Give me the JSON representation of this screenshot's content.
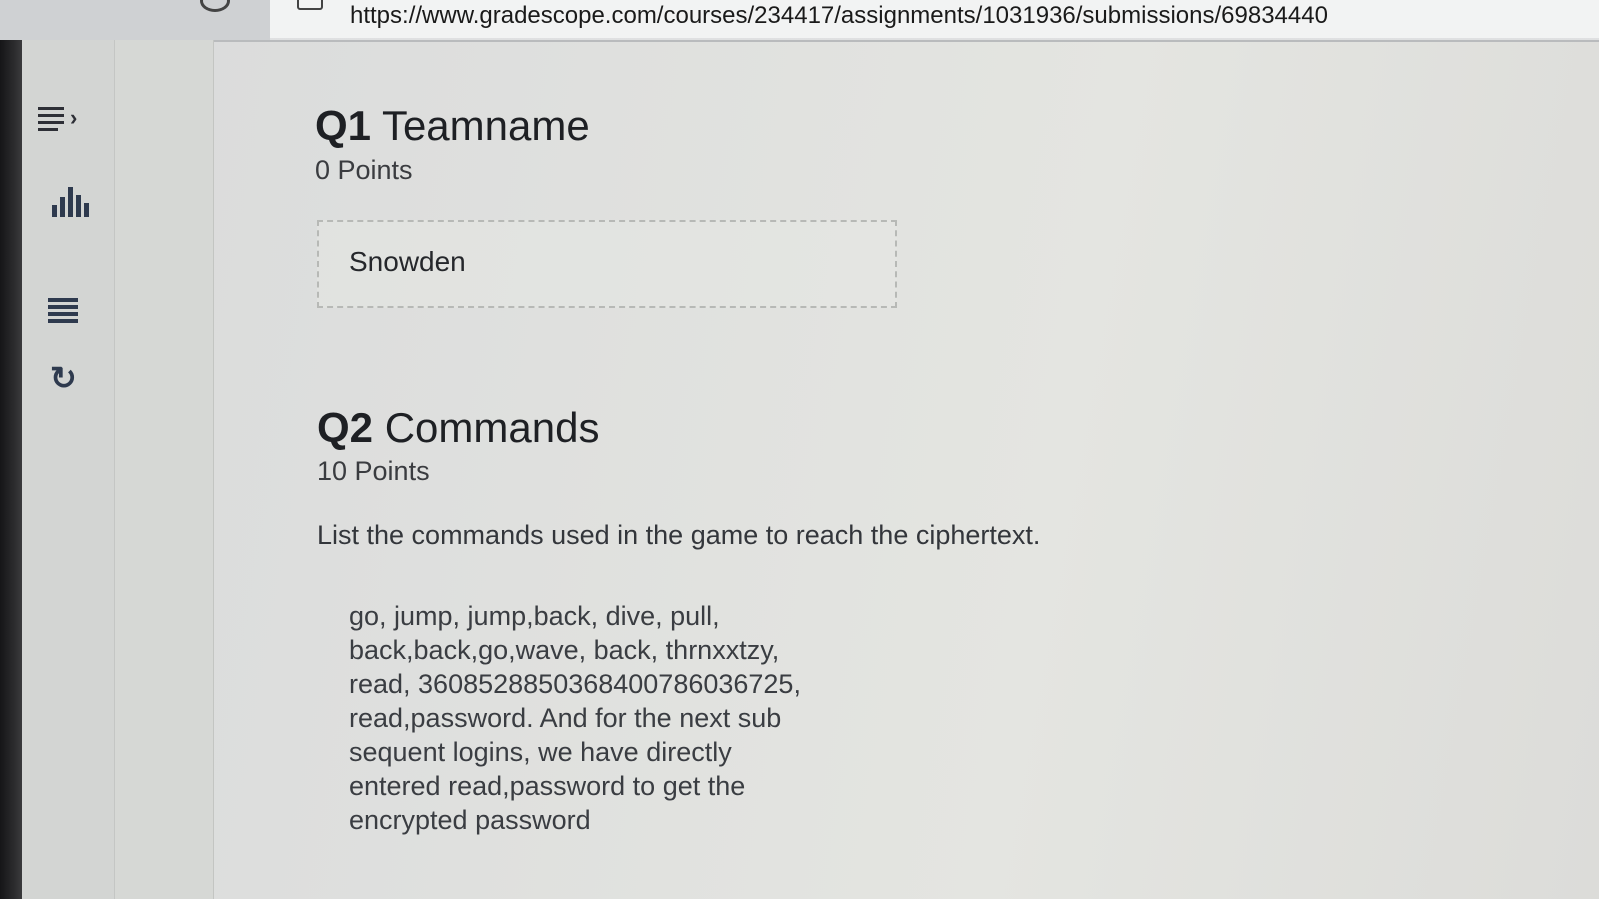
{
  "browser": {
    "url": "https://www.gradescope.com/courses/234417/assignments/1031936/submissions/69834440"
  },
  "sidebar": {
    "icons": [
      "menu-expand-icon",
      "statistics-icon",
      "submission-list-icon",
      "regrade-icon"
    ]
  },
  "questions": [
    {
      "number": "Q1",
      "title": "Teamname",
      "points": "0 Points",
      "answer": "Snowden"
    },
    {
      "number": "Q2",
      "title": "Commands",
      "points": "10 Points",
      "prompt": "List the commands used in the game to reach the ciphertext.",
      "answer": "go, jump, jump,back, dive, pull,\nback,back,go,wave, back, thrnxxtzy,\nread, 3608528850368400786036725,\nread,password. And for the next sub\nsequent logins, we have directly\nentered read,password to get the\nencrypted password"
    }
  ]
}
